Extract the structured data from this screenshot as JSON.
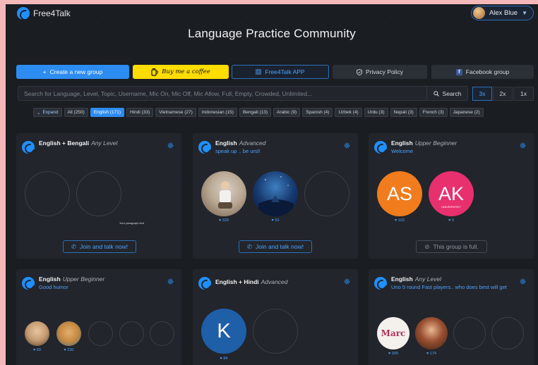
{
  "header": {
    "brand": "Free4Talk",
    "user_name": "Alex Blue",
    "page_title": "Language Practice Community"
  },
  "actions": {
    "create": "Create a new group",
    "coffee": "Buy me a coffee",
    "app": "Free4Talk APP",
    "privacy": "Privacy Policy",
    "facebook": "Facebook group"
  },
  "search": {
    "placeholder": "Search for Language, Level, Topic, Username, Mic On, Mic Off, Mic Allow, Full, Empty, Crowded, Unlimited...",
    "button": "Search"
  },
  "zoom": [
    "3x",
    "2x",
    "1x"
  ],
  "filters": {
    "expand": "Expand",
    "chips": [
      "All (250)",
      "English (171)",
      "Hindi (33)",
      "Vietnamese (27)",
      "Indonesian (15)",
      "Bengali (13)",
      "Arabic (9)",
      "Spanish (4)",
      "Uzbek (4)",
      "Urdu (3)",
      "Nepali (3)",
      "French (3)",
      "Japanese (2)"
    ],
    "active": "English (171)"
  },
  "cards": [
    {
      "language": "English + Bengali",
      "level": "Any Level",
      "topic": "",
      "tiny_text": "Your paragraph text",
      "button": "Join and talk now!"
    },
    {
      "language": "English",
      "level": "Advanced",
      "topic": "speak up .. be ursl!",
      "likes": [
        "329",
        "53"
      ],
      "button": "Join and talk now!"
    },
    {
      "language": "English",
      "level": "Upper Beginner",
      "topic": "Welcome",
      "avatars": [
        "AS",
        "AK"
      ],
      "avatar_sub": "UNIVERSITEIT",
      "likes": [
        "103",
        "0"
      ],
      "button": "This group is full."
    },
    {
      "language": "English",
      "level": "Upper Beginner",
      "topic": "Good humor",
      "likes": [
        "69",
        "230"
      ]
    },
    {
      "language": "English + Hindi",
      "level": "Advanced",
      "topic": "",
      "avatars": [
        "K"
      ],
      "likes": [
        "84"
      ]
    },
    {
      "language": "English",
      "level": "Any Level",
      "topic": "Uno 5 round Fast players.. who does best will get",
      "avatar_text": "Marc",
      "likes": [
        "309",
        "174"
      ]
    }
  ],
  "colors": {
    "accent": "#2d8cf0",
    "coffee": "#ffdd00",
    "avatar_as": "#f07c1e",
    "avatar_ak": "#e8306e",
    "avatar_k": "#1f5fa8"
  }
}
